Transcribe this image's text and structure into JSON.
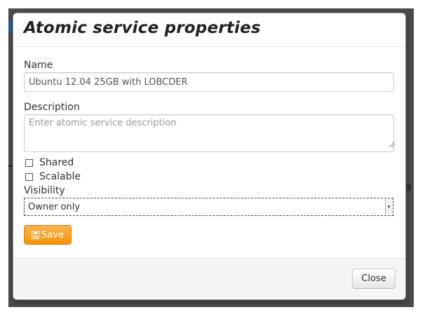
{
  "dialog": {
    "title": "Atomic service properties"
  },
  "form": {
    "name_label": "Name",
    "name_value": "Ubuntu 12.04 25GB with LOBCDER",
    "description_label": "Description",
    "description_placeholder": "Enter atomic service description",
    "description_value": "",
    "shared_label": "Shared",
    "shared_checked": false,
    "scalable_label": "Scalable",
    "scalable_checked": false,
    "visibility_label": "Visibility",
    "visibility_value": "Owner only",
    "save_label": "Save",
    "save_icon": "save-icon"
  },
  "footer": {
    "close_label": "Close"
  },
  "colors": {
    "save_button": "#f89406",
    "backdrop": "#4a4a4a"
  }
}
